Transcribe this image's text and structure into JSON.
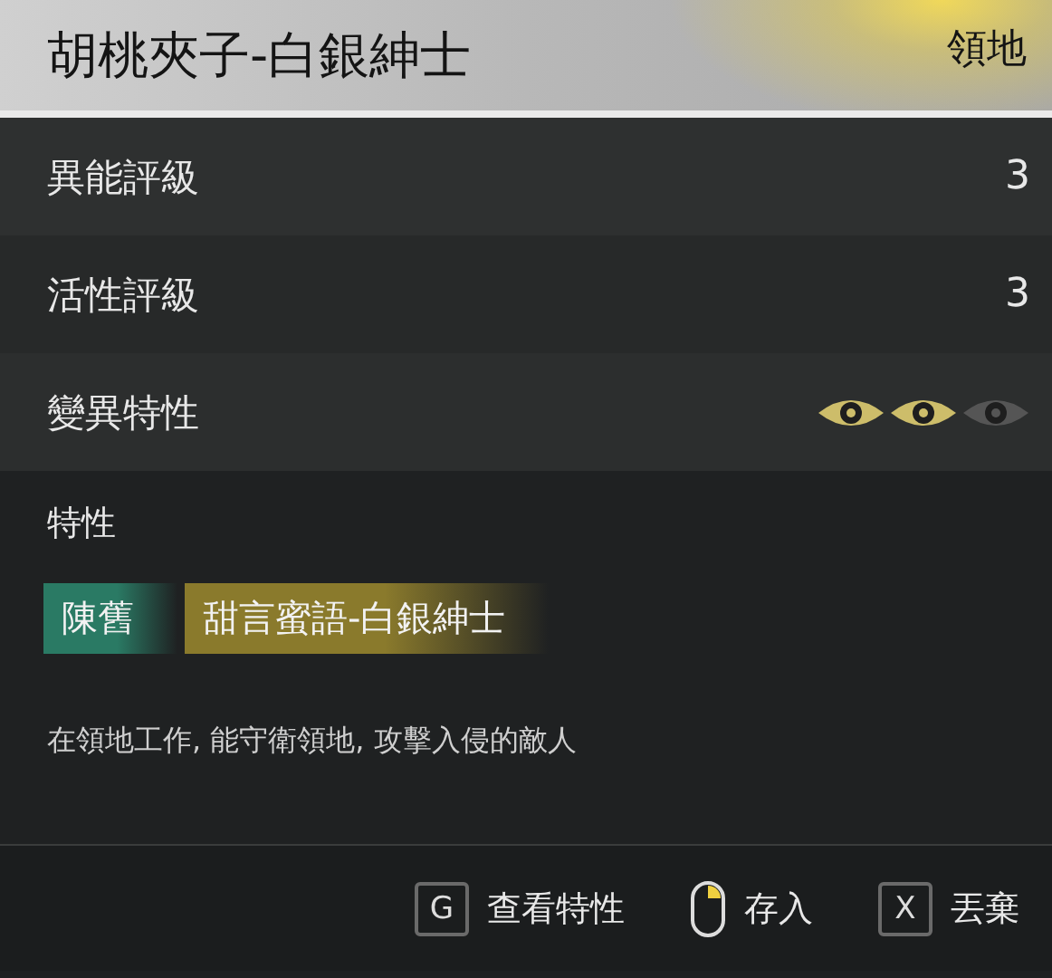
{
  "header": {
    "title": "胡桃夾子-白銀紳士",
    "category": "領地"
  },
  "stats": [
    {
      "label": "異能評級",
      "kind": "value",
      "value": "3"
    },
    {
      "label": "活性評級",
      "kind": "value",
      "value": "3"
    },
    {
      "label": "變異特性",
      "kind": "eyes",
      "eyes": [
        {
          "on": true
        },
        {
          "on": true
        },
        {
          "on": false
        }
      ]
    }
  ],
  "traits": {
    "heading": "特性",
    "items": [
      {
        "label": "陳舊",
        "color": "#2a7a64"
      },
      {
        "label": "甜言蜜語-白銀紳士",
        "color": "#8a7a2c"
      }
    ],
    "description": "在領地工作, 能守衛領地, 攻擊入侵的敵人"
  },
  "actions": [
    {
      "kind": "key",
      "key": "G",
      "label": "查看特性"
    },
    {
      "kind": "mouse",
      "label": "存入"
    },
    {
      "kind": "key",
      "key": "X",
      "label": "丟棄"
    }
  ]
}
